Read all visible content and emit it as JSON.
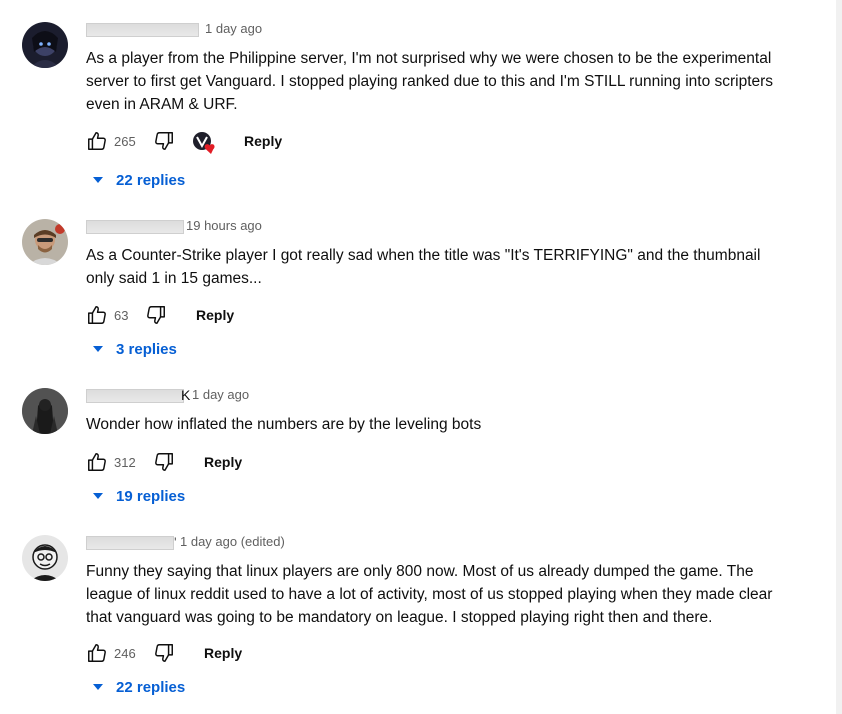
{
  "comments": [
    {
      "time": "1 day ago",
      "text": "As a player from the Philippine server, I'm not surprised why we were chosen to be the experimental server to first get Vanguard. I stopped playing ranked due to this and I'm STILL running into scripters even in ARAM & URF.",
      "likes": "265",
      "reply_label": "Reply",
      "replies_label": "22 replies"
    },
    {
      "time": "19 hours ago",
      "text": "As a Counter-Strike player I got really sad when the title was \"It's TERRIFYING\" and the thumbnail only said 1 in 15 games...",
      "likes": "63",
      "reply_label": "Reply",
      "replies_label": "3 replies"
    },
    {
      "name_tail": "K",
      "time": "1 day ago",
      "text": "Wonder how inflated the numbers are by the leveling bots",
      "likes": "312",
      "reply_label": "Reply",
      "replies_label": "19 replies"
    },
    {
      "name_tail": "'",
      "time": "1 day ago (edited)",
      "text": "Funny they saying that linux players are only 800 now. Most of us already dumped the game. The league of linux reddit used to have a lot of activity, most of us stopped playing when they made clear that vanguard was going to be mandatory on league. I stopped playing right then and there.",
      "likes": "246",
      "reply_label": "Reply",
      "replies_label": "22 replies"
    }
  ],
  "colors": {
    "link_blue": "#065fd4",
    "meta_gray": "#606060",
    "heart_red": "#e21d26"
  },
  "icons": {
    "like": "thumbs-up-icon",
    "dislike": "thumbs-down-icon",
    "creator_heart": "creator-heart-icon",
    "expand": "caret-down-icon"
  }
}
